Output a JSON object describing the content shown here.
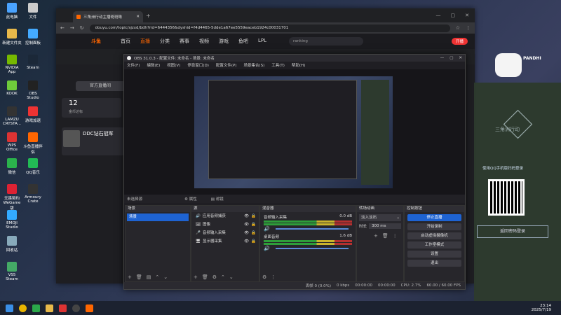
{
  "desktop": {
    "icons": [
      {
        "label": "此电脑",
        "color": "#4aa3ff"
      },
      {
        "label": "新建文件夹",
        "color": "#e8b94a"
      },
      {
        "label": "NVIDIA App",
        "color": "#76b900"
      },
      {
        "label": "KOOK",
        "color": "#6ecb3b"
      },
      {
        "label": "LAMZU CRYSTA...",
        "color": "#333"
      },
      {
        "label": "WPS Office",
        "color": "#d33"
      },
      {
        "label": "微信",
        "color": "#2bb24c"
      },
      {
        "label": "无畏契约 WeGame版",
        "color": "#d23"
      },
      {
        "label": "EMOJI Studio",
        "color": "#3af"
      },
      {
        "label": "回收站",
        "color": "#8ab"
      },
      {
        "label": "VS5 Steam",
        "color": "#4a6"
      }
    ],
    "icons2": [
      {
        "label": "文件",
        "color": "#ccc"
      },
      {
        "label": "控制面板",
        "color": "#4af"
      },
      {
        "label": "Steam",
        "color": "#1b2838"
      },
      {
        "label": "OBS Studio",
        "color": "#222"
      },
      {
        "label": "游戏加速",
        "color": "#e33"
      },
      {
        "label": "斗鱼直播伴侣",
        "color": "#f60"
      },
      {
        "label": "QQ音乐",
        "color": "#2b5"
      },
      {
        "label": "Armoury Crate",
        "color": "#333"
      }
    ]
  },
  "browser": {
    "tab_title": "三角洲行动主播斑斑啾",
    "url": "douyu.com/topic/sjzxd/bdh?rid=6444356&dyshid=f4d4465-5dde1a67ee5559eaceb1924c00031701",
    "site_nav": [
      "首页",
      "直播",
      "分类",
      "赛事",
      "视频",
      "游戏",
      "鱼吧",
      "LPL"
    ],
    "search_placeholder": "ranking",
    "login_label": "开播",
    "side_button": "官方直播间",
    "count_num": "12",
    "count_label": "金币达标",
    "streamer_title": "DDC钻石冠军"
  },
  "obs": {
    "title": "OBS 31.0.3 - 配置文件: 未命名 - 场景: 未命名",
    "menu": [
      "文件(F)",
      "编辑(E)",
      "视图(V)",
      "停靠窗口(D)",
      "配置文件(P)",
      "场景集合(S)",
      "工具(T)",
      "帮助(H)"
    ],
    "no_source": "未选择源",
    "props_label": "属性",
    "filters_label": "滤镜",
    "panels": {
      "scenes": "场景",
      "sources": "源",
      "mixer": "混音器",
      "transitions": "转场动画",
      "controls": "控制按钮"
    },
    "scene_items": [
      "场景"
    ],
    "source_items": [
      "应用音频捕获",
      "图像",
      "音频输入采集",
      "显示器采集"
    ],
    "mixer_channels": [
      {
        "name": "音频输入采集",
        "db": "0.0 dB"
      },
      {
        "name": "桌面音频",
        "db": "1.6 dB"
      }
    ],
    "transition": "淡入淡出",
    "duration_label": "时长",
    "duration_value": "300 ms",
    "controls": [
      {
        "label": "停止直播",
        "active": true
      },
      {
        "label": "开始录制",
        "active": false
      },
      {
        "label": "启动虚拟摄像机",
        "active": false
      },
      {
        "label": "工作室模式",
        "active": false
      },
      {
        "label": "设置",
        "active": false
      },
      {
        "label": "退出",
        "active": false
      }
    ],
    "status": {
      "frames": "丢帧 0 (0.0%)",
      "bitrate": "0 kbps",
      "rec_time": "00:00:00",
      "stream_time": "00:00:00",
      "cpu": "CPU: 2.7%",
      "fps": "60.00 / 60.00 FPS"
    }
  },
  "right_panel": {
    "brand": "PANDHI",
    "game_title": "三角洲行动",
    "login_hint": "使用QQ手机版扫码登录",
    "login_button": "返回密码登录"
  },
  "taskbar": {
    "time": "23:14",
    "date": "2025/7/19"
  }
}
